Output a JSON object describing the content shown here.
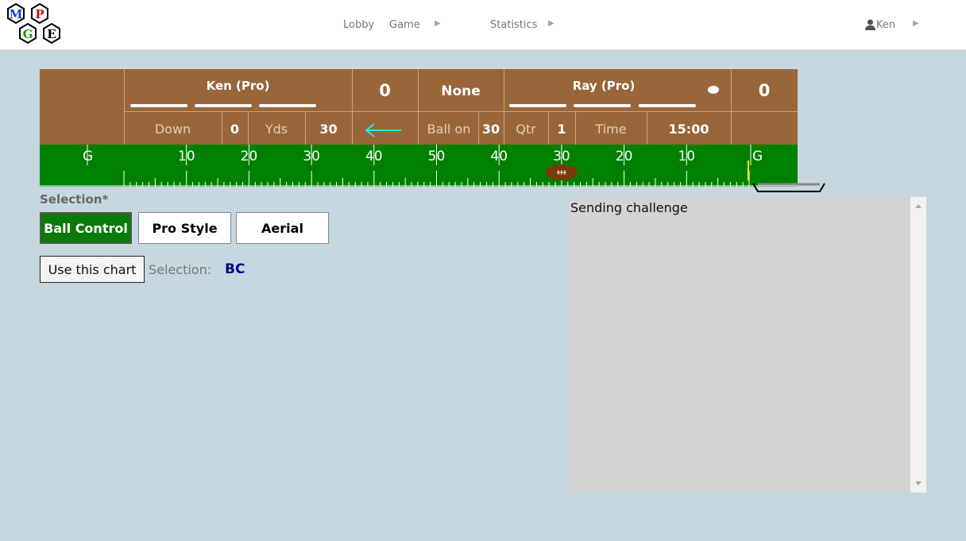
{
  "logo": {
    "letters": [
      "M",
      "P",
      "G",
      "E"
    ]
  },
  "nav": {
    "lobby": "Lobby",
    "game": "Game",
    "statistics": "Statistics",
    "user": "Ken"
  },
  "scoreboard": {
    "home": {
      "name": "Ken (Pro)",
      "score": "0"
    },
    "away": {
      "name": "Ray (Pro)",
      "score": "0"
    },
    "timeouts_label": "None",
    "down_label": "Down",
    "down": "0",
    "yds_label": "Yds",
    "yds": "30",
    "ball_on_label": "Ball on",
    "ball_on": "30",
    "qtr_label": "Qtr",
    "qtr": "1",
    "time_label": "Time",
    "time": "15:00",
    "direction": "left"
  },
  "field": {
    "labels": [
      "G",
      "10",
      "20",
      "30",
      "40",
      "50",
      "40",
      "30",
      "20",
      "10",
      "G"
    ],
    "ball_yardline": 30,
    "colors": {
      "field": "#008000",
      "ball": "#7a3a0a",
      "marker": "#ffff00"
    }
  },
  "selection": {
    "title": "Selection*",
    "options": [
      "Ball Control",
      "Pro Style",
      "Aerial"
    ],
    "active": "Ball Control",
    "use_button": "Use this chart",
    "label": "Selection:",
    "value": "BC"
  },
  "messages": {
    "text": "Sending challenge"
  }
}
